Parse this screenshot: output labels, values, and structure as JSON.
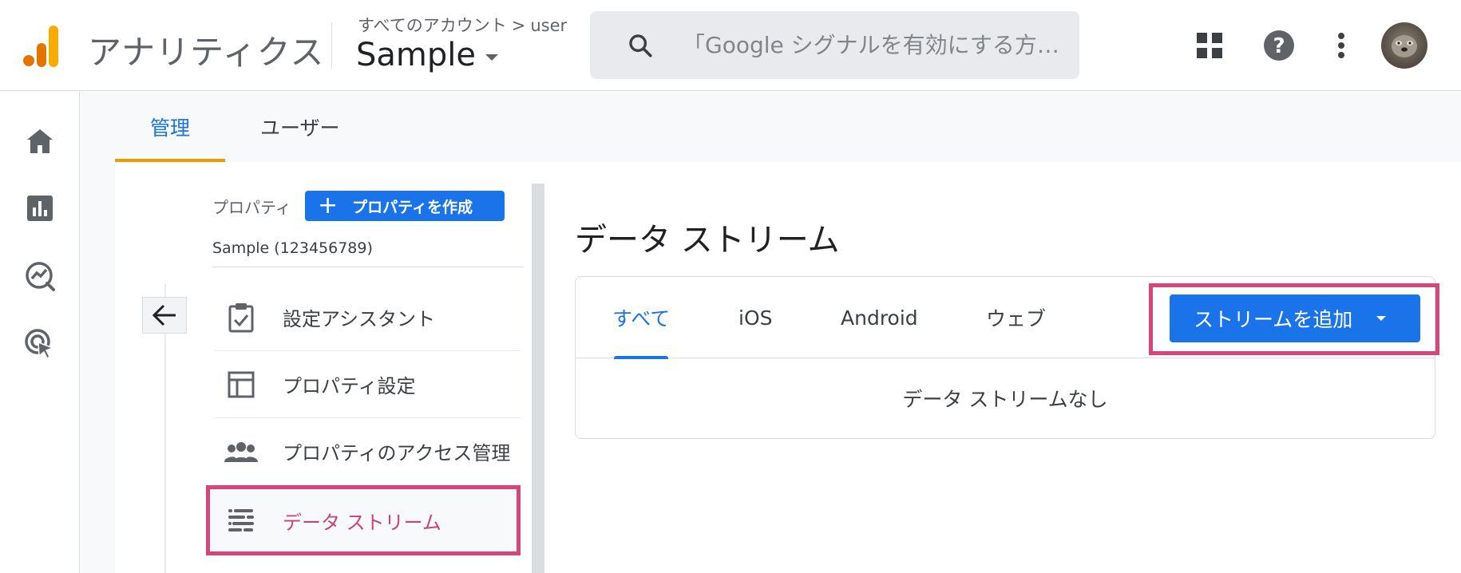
{
  "header": {
    "app_title": "アナリティクス",
    "breadcrumb": {
      "root": "すべてのアカウント",
      "separator": ">",
      "account": "user"
    },
    "property_name": "Sample",
    "search_placeholder": "「Google シグナルを有効にする方…",
    "icons": [
      "apps-grid-icon",
      "help-icon",
      "more-vert-icon"
    ]
  },
  "rail": {
    "items": [
      {
        "name": "home",
        "icon": "home-icon"
      },
      {
        "name": "reports",
        "icon": "bar-chart-icon"
      },
      {
        "name": "explore",
        "icon": "explore-icon"
      },
      {
        "name": "advertising",
        "icon": "cursor-target-icon"
      }
    ]
  },
  "admin_tabs": [
    {
      "label": "管理",
      "active": true
    },
    {
      "label": "ユーザー",
      "active": false
    }
  ],
  "property_panel": {
    "label": "プロパティ",
    "create_button": "プロパティを作成",
    "property_display": "Sample (123456789)",
    "nav_items": [
      {
        "label": "設定アシスタント",
        "icon": "clipboard-check-icon"
      },
      {
        "label": "プロパティ設定",
        "icon": "layout-icon"
      },
      {
        "label": "プロパティのアクセス管理",
        "icon": "people-icon"
      },
      {
        "label": "データ ストリーム",
        "icon": "data-stream-icon",
        "active": true
      }
    ]
  },
  "main": {
    "title": "データ ストリーム",
    "stream_tabs": [
      {
        "label": "すべて",
        "active": true
      },
      {
        "label": "iOS",
        "active": false
      },
      {
        "label": "Android",
        "active": false
      },
      {
        "label": "ウェブ",
        "active": false
      }
    ],
    "add_stream_button": "ストリームを追加",
    "empty_message": "データ ストリームなし"
  },
  "colors": {
    "accent_blue": "#1a73e8",
    "highlight_pink": "#d6467b",
    "tab_underline_orange": "#f29900",
    "logo_orange": "#f9ab00",
    "logo_dark_orange": "#e37400"
  }
}
